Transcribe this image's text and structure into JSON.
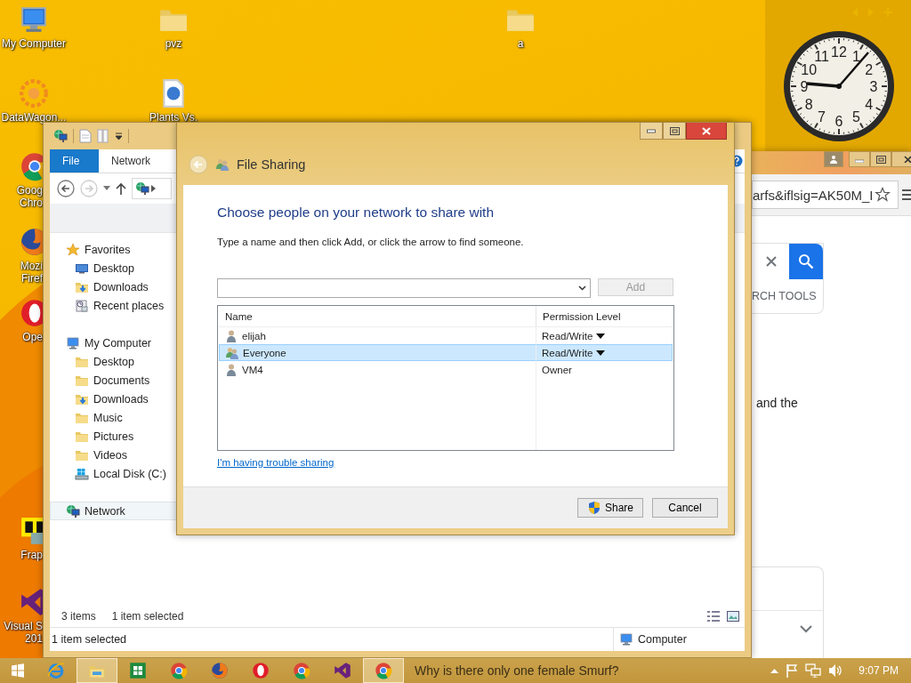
{
  "desktop": {
    "icons": [
      {
        "label": "My Computer",
        "kind": "computer"
      },
      {
        "label": "pvz",
        "kind": "folder"
      },
      {
        "label": "DataWagon...",
        "kind": "flower"
      },
      {
        "label": "Plants Vs.",
        "kind": "file"
      },
      {
        "label": "a",
        "kind": "folder"
      },
      {
        "label": "Goog\nChro",
        "kind": "chrome"
      },
      {
        "label": "Mozi\nFiref",
        "kind": "firefox"
      },
      {
        "label": "Ope",
        "kind": "opera"
      },
      {
        "label": "Frap",
        "kind": "fraps"
      },
      {
        "label": "Visual S\n201",
        "kind": "vs"
      }
    ]
  },
  "clock_gadget": {
    "numerals": [
      "11",
      "12",
      "1",
      "10",
      "2",
      "9",
      "3",
      "8",
      "4",
      "7",
      "5",
      "6"
    ]
  },
  "browser_window": {
    "address": "arfs&iflsig=AK50M_I",
    "search_tools": "RCH TOOLS",
    "snippet": "and the"
  },
  "explorer": {
    "ribbon_tabs": [
      {
        "label": "File",
        "kind": "menu"
      },
      {
        "label": "Network",
        "kind": "tab"
      }
    ],
    "tree": [
      {
        "label": "Favorites",
        "kind": "star",
        "selected": false,
        "children": [
          {
            "label": "Desktop",
            "kind": "monitor",
            "selected": false
          },
          {
            "label": "Downloads",
            "kind": "downloads",
            "selected": false
          },
          {
            "label": "Recent places",
            "kind": "recent",
            "selected": false
          }
        ]
      },
      {
        "label": "My Computer",
        "kind": "computer",
        "selected": false,
        "children": [
          {
            "label": "Desktop",
            "kind": "folder",
            "selected": false
          },
          {
            "label": "Documents",
            "kind": "folder",
            "selected": false
          },
          {
            "label": "Downloads",
            "kind": "downloads",
            "selected": false
          },
          {
            "label": "Music",
            "kind": "folder",
            "selected": false
          },
          {
            "label": "Pictures",
            "kind": "folder",
            "selected": false
          },
          {
            "label": "Videos",
            "kind": "folder",
            "selected": false
          },
          {
            "label": "Local Disk (C:)",
            "kind": "disk",
            "selected": false
          }
        ]
      },
      {
        "label": "Network",
        "kind": "network",
        "selected": true
      }
    ],
    "status_bar": {
      "count": "3 items",
      "selection": "1 item selected"
    },
    "details_bar": {
      "selection": "1 item selected",
      "location": "Computer"
    }
  },
  "dialog": {
    "title": "File Sharing",
    "heading": "Choose people on your network to share with",
    "instruction": "Type a name and then click Add, or click the arrow to find someone.",
    "add_button": {
      "label": "Add",
      "disabled": true
    },
    "table": {
      "columns": [
        "Name",
        "Permission Level"
      ],
      "rows": [
        {
          "name": "elijah",
          "kind": "user",
          "permission": "Read/Write",
          "dropdown": true,
          "selected": false
        },
        {
          "name": "Everyone",
          "kind": "group",
          "permission": "Read/Write",
          "dropdown": true,
          "selected": true
        },
        {
          "name": "VM4",
          "kind": "user",
          "permission": "Owner",
          "dropdown": false,
          "selected": false
        }
      ]
    },
    "help_link": "I'm having trouble sharing",
    "buttons": [
      {
        "label": "Share",
        "kind": "shield"
      },
      {
        "label": "Cancel",
        "kind": "plain"
      }
    ]
  },
  "taskbar": {
    "items": [
      {
        "kind": "start",
        "active": false
      },
      {
        "kind": "ie",
        "active": false
      },
      {
        "kind": "explorer",
        "active": true
      },
      {
        "kind": "excel",
        "active": false
      },
      {
        "kind": "chrome",
        "active": false
      },
      {
        "kind": "firefox",
        "active": false
      },
      {
        "kind": "opera",
        "active": false
      },
      {
        "kind": "chrome",
        "active": false
      },
      {
        "kind": "vs",
        "active": false
      },
      {
        "kind": "chrome",
        "active": true
      }
    ],
    "window_title": "Why is there only one female Smurf?",
    "time": "9:07 PM"
  }
}
